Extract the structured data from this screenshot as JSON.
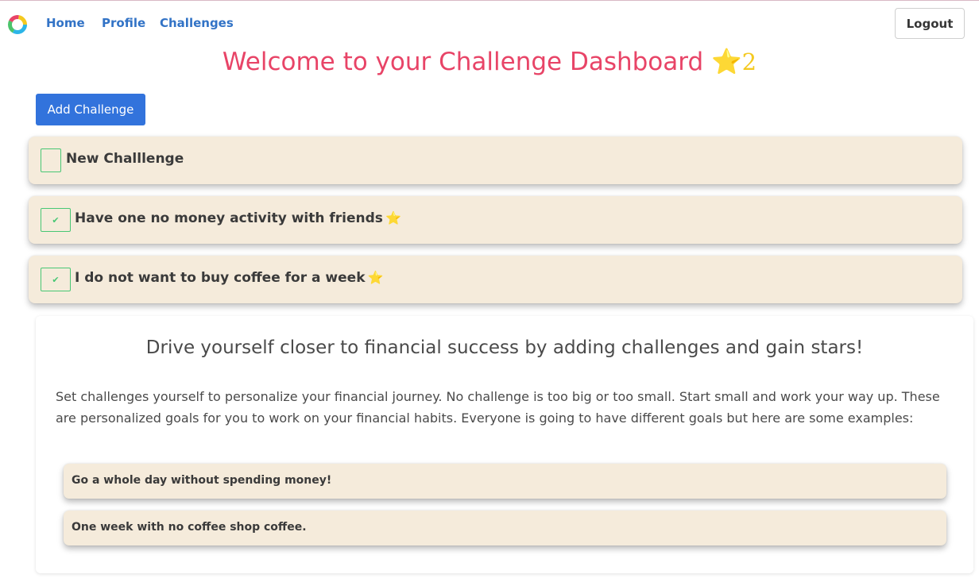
{
  "nav": {
    "logo_icon": "circular-logo-icon",
    "home": "Home",
    "profile": "Profile",
    "challenges": "Challenges",
    "logout": "Logout"
  },
  "header": {
    "title": "Welcome to your Challenge Dashboard",
    "star_icon": "star-icon",
    "star_glyph": "⭐",
    "star_count": "2"
  },
  "actions": {
    "add_challenge": "Add Challenge"
  },
  "challenges": [
    {
      "label": "New Challlenge",
      "completed": false,
      "star": ""
    },
    {
      "label": "Have one no money activity with friends",
      "completed": true,
      "star": "⭐"
    },
    {
      "label": "I do not want to buy coffee for a week",
      "completed": true,
      "star": "⭐"
    }
  ],
  "checkmark_glyph": "✔",
  "info": {
    "heading": "Drive yourself closer to financial success by adding challenges and gain stars!",
    "paragraph": "Set challenges yourself to personalize your financial journey. No challenge is too big or too small. Start small and work your way up. These are personalized goals for you to work on your financial habits. Everyone is going to have different goals but here are some examples:",
    "examples": [
      "Go a whole day without spending money!",
      "One week with no coffee shop coffee."
    ]
  },
  "colors": {
    "title": "#e84467",
    "nav_link": "#3273c6",
    "primary_button": "#3273dc",
    "card_background": "#f5ebdb",
    "check_green": "#48c774",
    "star_yellow": "#f4c920"
  }
}
